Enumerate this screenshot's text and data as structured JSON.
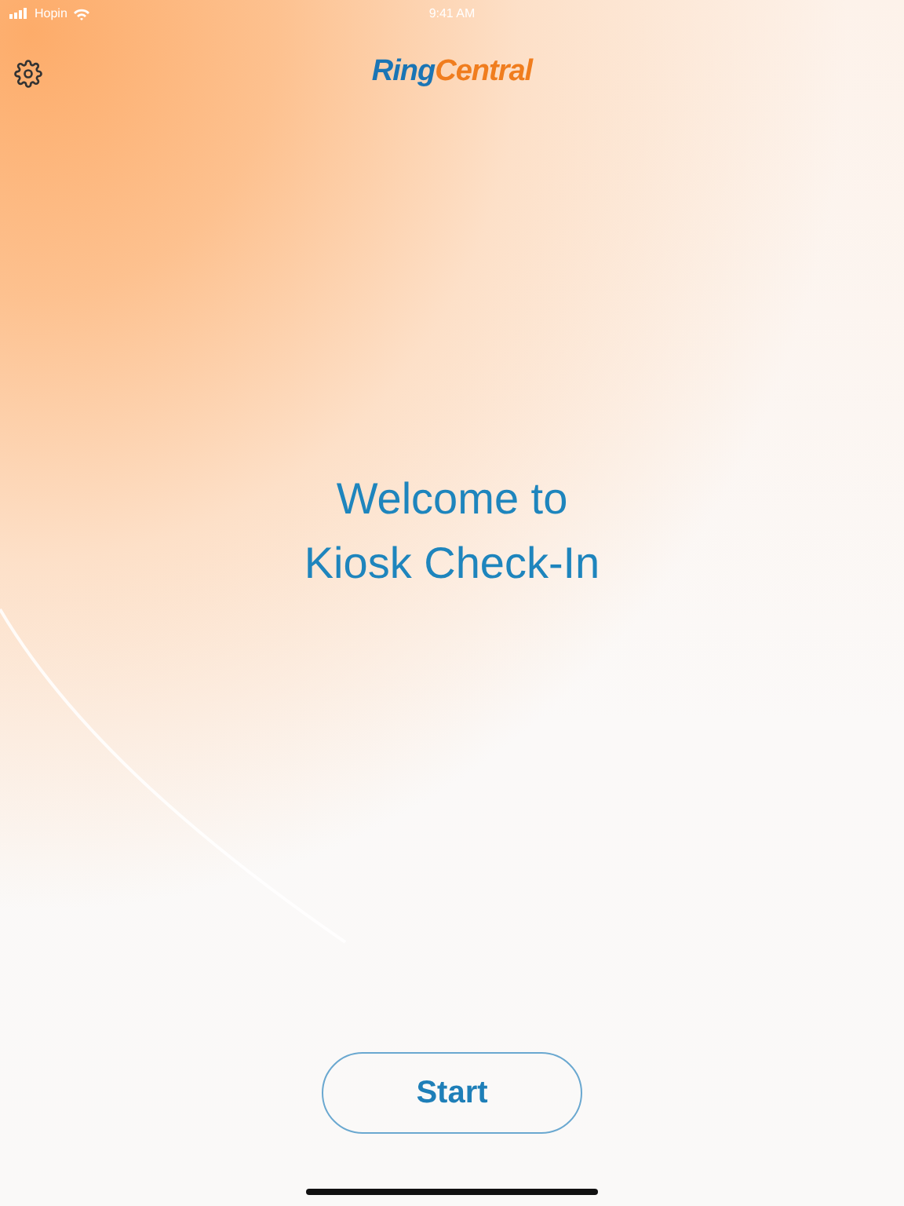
{
  "status_bar": {
    "carrier": "Hopin",
    "time": "9:41 AM"
  },
  "header": {
    "logo": [
      "Ring",
      "Central"
    ]
  },
  "welcome": [
    "Welcome to",
    "Kiosk Check-In"
  ],
  "start_button": "Start"
}
